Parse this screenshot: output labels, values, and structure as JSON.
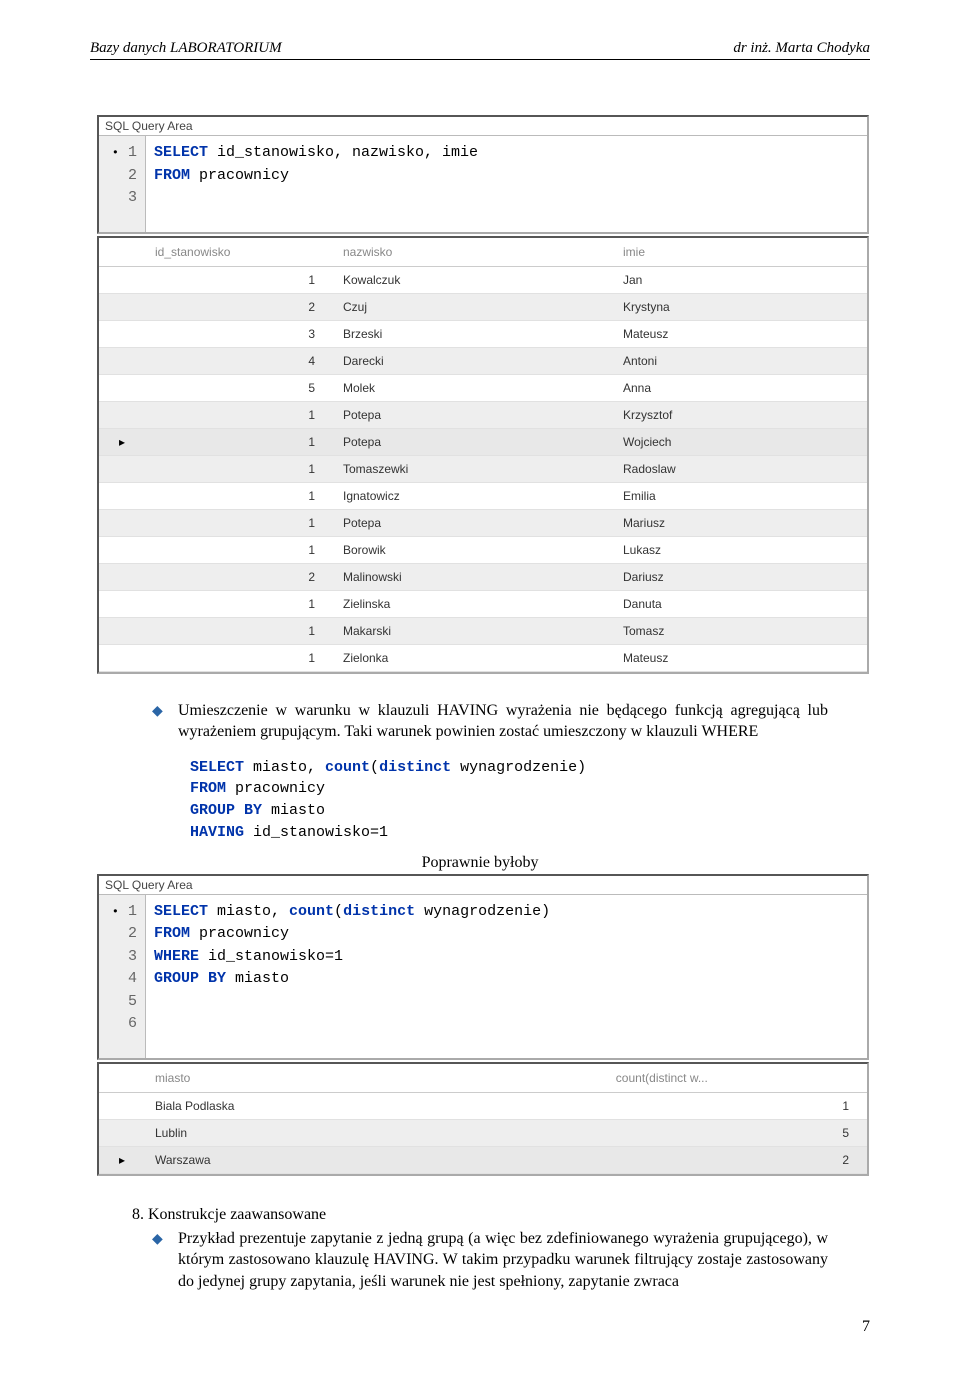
{
  "header": {
    "left": "Bazy danych LABORATORIUM",
    "right": "dr inż. Marta Chodyka"
  },
  "panel1": {
    "title": "SQL Query Area",
    "lines": [
      [
        {
          "kw": "SELECT"
        },
        {
          "t": " id_stanowisko, nazwisko, imie"
        }
      ],
      [
        {
          "kw": "FROM"
        },
        {
          "t": " pracownicy"
        }
      ],
      [
        {
          "t": ""
        }
      ]
    ],
    "headers": [
      "",
      "id_stanowisko",
      "nazwisko",
      "imie"
    ],
    "rows": [
      [
        "",
        "1",
        "Kowalczuk",
        "Jan"
      ],
      [
        "",
        "2",
        "Czuj",
        "Krystyna"
      ],
      [
        "",
        "3",
        "Brzeski",
        "Mateusz"
      ],
      [
        "",
        "4",
        "Darecki",
        "Antoni"
      ],
      [
        "",
        "5",
        "Molek",
        "Anna"
      ],
      [
        "",
        "1",
        "Potepa",
        "Krzysztof"
      ],
      [
        "▸",
        "1",
        "Potepa",
        "Wojciech"
      ],
      [
        "",
        "1",
        "Tomaszewki",
        "Radoslaw"
      ],
      [
        "",
        "1",
        "Ignatowicz",
        "Emilia"
      ],
      [
        "",
        "1",
        "Potepa",
        "Mariusz"
      ],
      [
        "",
        "1",
        "Borowik",
        "Lukasz"
      ],
      [
        "",
        "2",
        "Malinowski",
        "Dariusz"
      ],
      [
        "",
        "1",
        "Zielinska",
        "Danuta"
      ],
      [
        "",
        "1",
        "Makarski",
        "Tomasz"
      ],
      [
        "",
        "1",
        "Zielonka",
        "Mateusz"
      ]
    ]
  },
  "para1": "Umieszczenie w warunku w klauzuli HAVING wyrażenia nie będącego funkcją agregującą lub wyrażeniem grupującym. Taki warunek powinien zostać umieszczony w klauzuli WHERE",
  "code_block": [
    [
      {
        "kw": "SELECT"
      },
      {
        "t": " miasto, "
      },
      {
        "kw": "count"
      },
      {
        "t": "("
      },
      {
        "kw": "distinct"
      },
      {
        "t": " wynagrodzenie)"
      }
    ],
    [
      {
        "kw": "FROM"
      },
      {
        "t": " pracownicy"
      }
    ],
    [
      {
        "kw": "GROUP BY"
      },
      {
        "t": " miasto"
      }
    ],
    [
      {
        "kw": "HAVING"
      },
      {
        "t": " id_stanowisko=1"
      }
    ]
  ],
  "center_label": "Poprawnie byłoby",
  "panel2": {
    "title": "SQL Query Area",
    "lines": [
      [
        {
          "kw": "SELECT"
        },
        {
          "t": " miasto, "
        },
        {
          "kw": "count"
        },
        {
          "t": "("
        },
        {
          "kw": "distinct"
        },
        {
          "t": " wynagrodzenie)"
        }
      ],
      [
        {
          "kw": "FROM"
        },
        {
          "t": " pracownicy"
        }
      ],
      [
        {
          "kw": "WHERE"
        },
        {
          "t": " id_stanowisko=1"
        }
      ],
      [
        {
          "kw": "GROUP BY"
        },
        {
          "t": " miasto"
        }
      ],
      [
        {
          "t": ""
        }
      ],
      [
        {
          "t": ""
        }
      ]
    ],
    "headers": [
      "",
      "miasto",
      "count(distinct w..."
    ],
    "rows": [
      [
        "",
        "Biala Podlaska",
        "1"
      ],
      [
        "",
        "Lublin",
        "5"
      ],
      [
        "▸",
        "Warszawa",
        "2"
      ]
    ]
  },
  "section8": {
    "heading": "8. Konstrukcje zaawansowane",
    "text": "Przykład prezentuje zapytanie z jedną grupą (a więc bez zdefiniowanego wyrażenia grupującego), w którym zastosowano klauzulę HAVING. W takim przypadku warunek filtrujący zostaje zastosowany do jedynej grupy zapytania, jeśli warunek nie jest spełniony, zapytanie zwraca"
  },
  "pagenum": "7"
}
